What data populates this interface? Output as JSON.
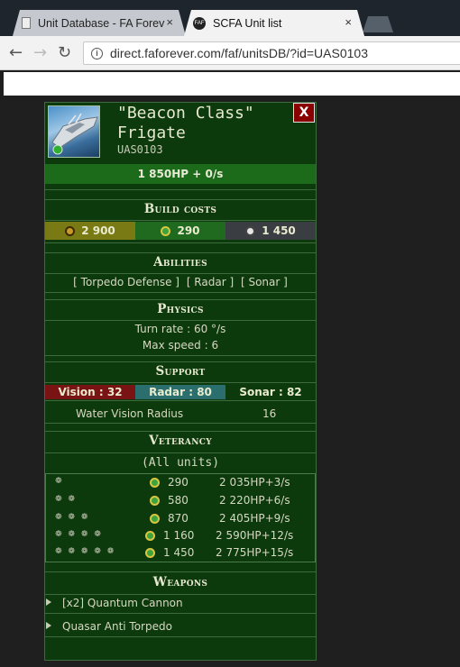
{
  "browser": {
    "tabs": [
      {
        "title": "Unit Database - FA Forev",
        "close": "×"
      },
      {
        "title": "SCFA Unit list",
        "close": "×"
      }
    ],
    "url": "direct.faforever.com/faf/unitsDB/?id=UAS0103",
    "info_icon": "i",
    "faf_icon_text": "FAF"
  },
  "unit": {
    "name_line1": "\"Beacon Class\"",
    "name_line2": "Frigate",
    "id": "UAS0103",
    "close": "X",
    "hp_line": "1 850HP + 0/s"
  },
  "build_costs": {
    "title": "Build costs",
    "mass": "2 900",
    "energy": "290",
    "time": "1 450"
  },
  "abilities": {
    "title": "Abilities",
    "items": [
      "[ Torpedo Defense ]",
      "[ Radar ]",
      "[ Sonar ]"
    ]
  },
  "physics": {
    "title": "Physics",
    "turn_rate": "Turn rate : 60 °/s",
    "max_speed": "Max speed : 6"
  },
  "support": {
    "title": "Support",
    "vision": "Vision : 32",
    "radar": "Radar : 80",
    "sonar": "Sonar : 82",
    "water_vision_label": "Water Vision Radius",
    "water_vision_value": "16"
  },
  "veterancy": {
    "title": "Veterancy",
    "subtitle": "(All units)",
    "rows": [
      {
        "level": 1,
        "stars": "❁",
        "mass": "290",
        "hp": "2 035HP+3/s"
      },
      {
        "level": 2,
        "stars": "❁ ❁",
        "mass": "580",
        "hp": "2 220HP+6/s"
      },
      {
        "level": 3,
        "stars": "❁ ❁ ❁",
        "mass": "870",
        "hp": "2 405HP+9/s"
      },
      {
        "level": 4,
        "stars": "❁ ❁ ❁ ❁",
        "mass": "1 160",
        "hp": "2 590HP+12/s"
      },
      {
        "level": 5,
        "stars": "❁ ❁ ❁ ❁ ❁",
        "mass": "1 450",
        "hp": "2 775HP+15/s"
      }
    ]
  },
  "weapons": {
    "title": "Weapons",
    "items": [
      "[x2] Quantum Cannon",
      "Quasar Anti Torpedo"
    ]
  },
  "colors": {
    "panel_bg": "#0d3a0d",
    "hp_bar": "#1b6b1b",
    "mass_cost_bg": "#7a7a14",
    "energy_cost_bg": "#1f6a1f",
    "time_cost_bg": "#3a3d42",
    "vision_bg": "#7a1414",
    "radar_bg": "#2a6e6e",
    "sonar_bg": "#0d3a0d"
  }
}
